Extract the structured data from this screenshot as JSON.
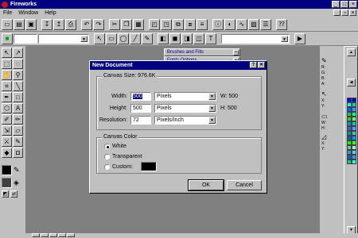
{
  "app": {
    "title": "Fireworks"
  },
  "menu": {
    "items": [
      "File",
      "Window",
      "Help"
    ]
  },
  "toolbar2": {
    "font_size_value": ""
  },
  "panels": {
    "brushes_fills": "Brushes and Fills",
    "second": "Fonts Options"
  },
  "info": {
    "r": "R:",
    "g": "G:",
    "b": "B:",
    "a": "A:",
    "x": "X:",
    "y": "Y:",
    "w": "W:",
    "h": "H:",
    "x2": "X:",
    "y2": "Y:"
  },
  "dialog": {
    "title": "New Document",
    "help_btn": "?",
    "close_btn": "✕",
    "canvas_size_label": "Canvas Size: 976.6K",
    "width_label": "Width:",
    "width_value": "500",
    "width_unit": "Pixels",
    "width_info": "W: 500",
    "height_label": "Height:",
    "height_value": "500",
    "height_unit": "Pixels",
    "height_info": "H: 500",
    "resolution_label": "Resolution:",
    "resolution_value": "72",
    "resolution_unit": "Pixels/Inch",
    "canvas_color_label": "Canvas Color",
    "options": [
      {
        "label": "White",
        "selected": true
      },
      {
        "label": "Transparent",
        "selected": false
      },
      {
        "label": "Custom:",
        "selected": false
      }
    ],
    "custom_color": "#000000",
    "ok": "OK",
    "cancel": "Cancel"
  },
  "colors": {
    "titlebar": "#000080",
    "workspace": "#808080",
    "face": "#c0c0c0"
  },
  "palette": [
    "#0000ff",
    "#0000cc",
    "#00ffff",
    "#00cccc",
    "#0066ff",
    "#3399ff",
    "#00cc66",
    "#00ff99",
    "#33cc33",
    "#66ff66",
    "#0099cc",
    "#00cccc",
    "#3366cc",
    "#6699ff",
    "#009999",
    "#33cccc",
    "#006699",
    "#0099ff",
    "#00ff00",
    "#33ff33",
    "#66cc99",
    "#99ffcc",
    "#3399cc",
    "#66ccff",
    "#0066cc",
    "#3399ff",
    "#00cc99",
    "#33ffcc"
  ]
}
